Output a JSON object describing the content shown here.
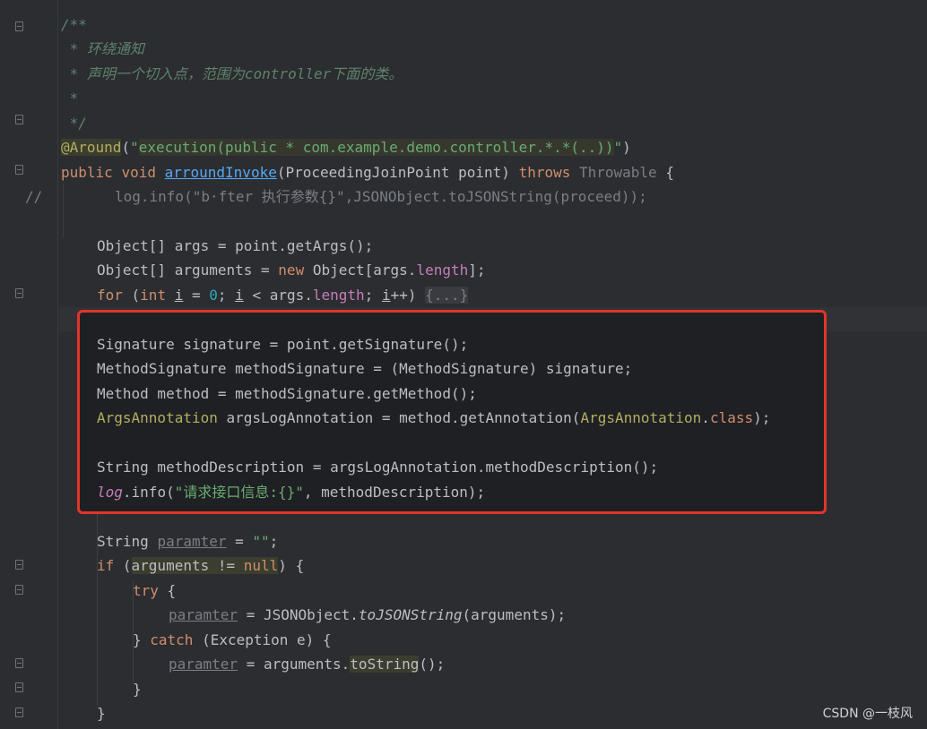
{
  "code": {
    "l1": "/**",
    "l2": " * 环绕通知",
    "l3": " * 声明一个切入点，范围为controller下面的类。",
    "l4": " *",
    "l5": " */",
    "l6_ann": "@Around",
    "l6_open": "(",
    "l6_str1": "\"",
    "l6_str": "execution(public * com.example.demo.controller.*.*(..))",
    "l6_str2": "\"",
    "l6_close": ")",
    "l7_kw1": "public",
    "l7_kw2": "void",
    "l7_fn": "arroundInvoke",
    "l7_params": "(ProceedingJoinPoint point) ",
    "l7_throws": "throws",
    "l7_exc": " Throwable ",
    "l7_brace": "{",
    "l8_comment_marker": "//",
    "l8_text": "log.info(\"b·fter 执行参数{}\",JSONObject.toJSONString(proceed));",
    "l9": "Object[] args = point.getArgs();",
    "l10_a": "Object[] arguments = ",
    "l10_new": "new",
    "l10_b": " Object[args.",
    "l10_len": "length",
    "l10_c": "];",
    "l11_for": "for",
    "l11_a": " (",
    "l11_int": "int",
    "l11_i": "i",
    "l11_b": " = ",
    "l11_zero": "0",
    "l11_c": "; ",
    "l11_i2": "i",
    "l11_d": " < args.",
    "l11_len": "length",
    "l11_e": "; ",
    "l11_i3": "i",
    "l11_f": "++) ",
    "l11_fold": "{...}",
    "l13": "Signature signature = point.getSignature();",
    "l14": "MethodSignature methodSignature = (MethodSignature) signature;",
    "l15": "Method method = methodSignature.getMethod();",
    "l16_cls": "ArgsAnnotation",
    "l16_a": " argsLogAnnotation = method.getAnnotation(",
    "l16_cls2": "ArgsAnnotation",
    "l16_dot": ".",
    "l16_class": "class",
    "l16_end": ");",
    "l18": "String methodDescription = argsLogAnnotation.methodDescription();",
    "l19_log": "log",
    "l19_a": ".info(",
    "l19_str": "\"请求接口信息:{}\"",
    "l19_b": ", methodDescription);",
    "l21_a": "String ",
    "l21_var": "paramter",
    "l21_b": " = ",
    "l21_str": "\"\"",
    "l21_c": ";",
    "l22_if": "if",
    "l22_a": " (",
    "l22_cond": "arguments != ",
    "l22_null": "null",
    "l22_b": ") {",
    "l23_try": "try",
    "l23_b": " {",
    "l24_var": "paramter",
    "l24_a": " = JSONObject.",
    "l24_fn": "toJSONString",
    "l24_b": "(arguments);",
    "l25_a": "} ",
    "l25_catch": "catch",
    "l25_b": " (Exception e) {",
    "l26_var": "paramter",
    "l26_a": " = arguments.",
    "l26_fn": "toString",
    "l26_b": "();",
    "l27": "}",
    "l28": "}"
  },
  "watermark": "CSDN @一枝风",
  "colors": {
    "background": "#2b2d30",
    "keyword": "#cf8e6d",
    "string": "#6aab73",
    "comment": "#5f826b",
    "annotation": "#b3ae60",
    "highlight_box": "#e3352a"
  }
}
